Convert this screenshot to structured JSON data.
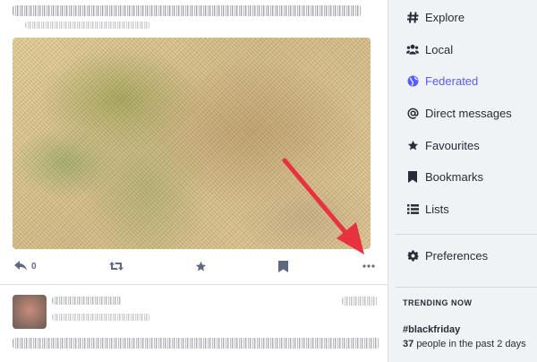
{
  "nav": {
    "items": [
      {
        "label": "Explore",
        "icon": "hashtag-icon",
        "active": false
      },
      {
        "label": "Local",
        "icon": "users-icon",
        "active": false
      },
      {
        "label": "Federated",
        "icon": "globe-icon",
        "active": true
      },
      {
        "label": "Direct messages",
        "icon": "at-icon",
        "active": false
      },
      {
        "label": "Favourites",
        "icon": "star-icon",
        "active": false
      },
      {
        "label": "Bookmarks",
        "icon": "bookmark-icon",
        "active": false
      },
      {
        "label": "Lists",
        "icon": "list-icon",
        "active": false
      }
    ],
    "preferences": {
      "label": "Preferences",
      "icon": "gear-icon"
    }
  },
  "status": {
    "reply_count": "0"
  },
  "trending": {
    "title": "TRENDING NOW",
    "tag": "#blackfriday",
    "people": "37",
    "people_suffix": "people in the past 2 days"
  },
  "colors": {
    "accent": "#595aff",
    "text": "#282c37",
    "icon": "#606984",
    "sidebar_bg": "#eff3f5",
    "arrow": "#e8323f"
  }
}
